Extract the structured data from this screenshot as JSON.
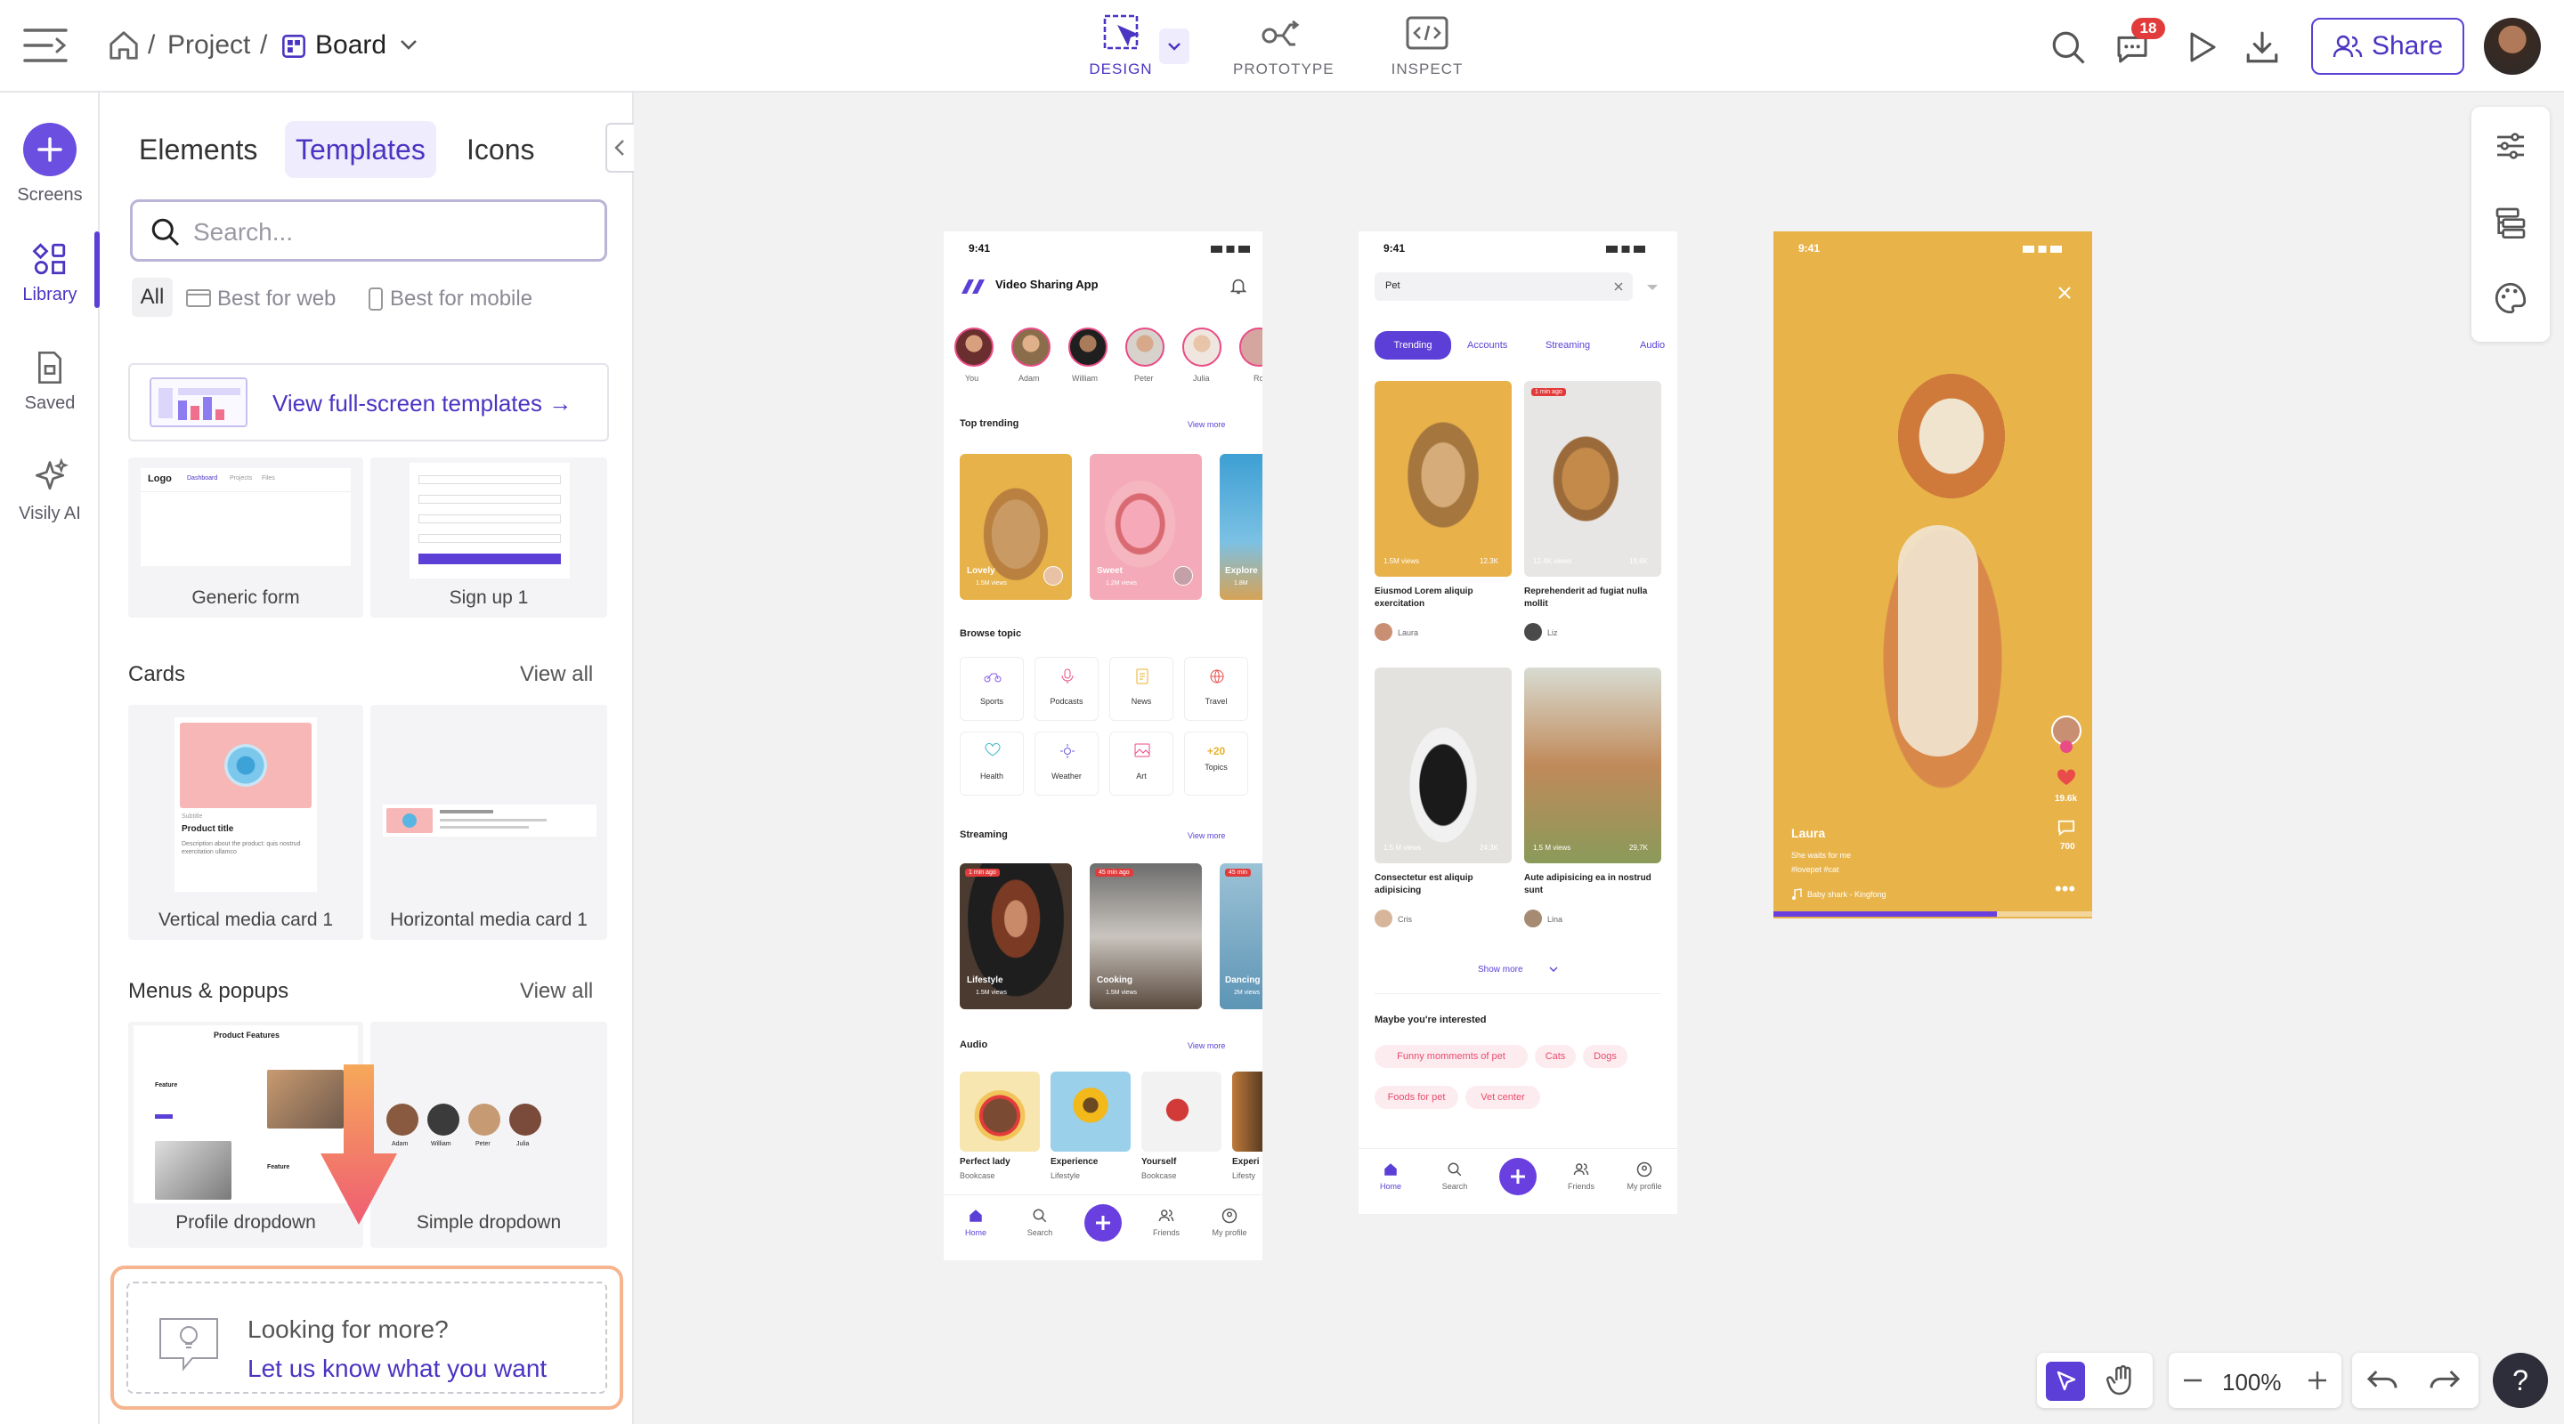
{
  "header": {
    "breadcrumb": {
      "project": "Project",
      "separator": "/",
      "board": "Board"
    },
    "modes": [
      {
        "label": "DESIGN"
      },
      {
        "label": "PROTOTYPE"
      },
      {
        "label": "INSPECT"
      }
    ],
    "notifications_count": "18",
    "share_label": "Share"
  },
  "leftnav": {
    "items": [
      {
        "label": "Screens"
      },
      {
        "label": "Library"
      },
      {
        "label": "Saved"
      },
      {
        "label": "Visily AI"
      }
    ]
  },
  "panel": {
    "tabs": [
      {
        "label": "Elements"
      },
      {
        "label": "Templates"
      },
      {
        "label": "Icons"
      }
    ],
    "active_tab": "Templates",
    "search_placeholder": "Search...",
    "filters": [
      {
        "label": "All"
      },
      {
        "label": "Best for web"
      },
      {
        "label": "Best for mobile"
      }
    ],
    "fullscreen_link": "View full-screen templates →",
    "top_templates": [
      {
        "label": "Generic form"
      },
      {
        "label": "Sign up 1"
      }
    ],
    "sections": [
      {
        "title": "Cards",
        "view_all": "View all",
        "items": [
          {
            "label": "Vertical media card 1"
          },
          {
            "label": "Horizontal media card 1"
          }
        ]
      },
      {
        "title": "Menus & popups",
        "view_all": "View all",
        "items": [
          {
            "label": "Profile dropdown"
          },
          {
            "label": "Simple dropdown"
          }
        ]
      }
    ],
    "feedback": {
      "line1": "Looking for more?",
      "line2": "Let us know what you want"
    },
    "preview_text": {
      "logo": "Logo",
      "dash": "Dashboard",
      "projects": "Projects",
      "files": "Files",
      "subtitle": "Subtitle",
      "product_title": "Product title",
      "desc": "Description about the product: quis nostrud exercitation ullamco",
      "product_features": "Product Features",
      "feature": "Feature",
      "people": [
        "Adam",
        "William",
        "Peter",
        "Julia"
      ]
    }
  },
  "screen1": {
    "time": "9:41",
    "app_title": "Video Sharing App",
    "stories": [
      {
        "name": "You"
      },
      {
        "name": "Adam"
      },
      {
        "name": "William"
      },
      {
        "name": "Peter"
      },
      {
        "name": "Julia"
      },
      {
        "name": "Ro"
      }
    ],
    "top_trending": "Top trending",
    "view_more": "View more",
    "trending_cards": [
      {
        "title": "Lovely",
        "views": "1.5M views"
      },
      {
        "title": "Sweet",
        "views": "1.2M views"
      },
      {
        "title": "Explore",
        "views": "1.8M"
      }
    ],
    "browse_topic": "Browse topic",
    "topics": [
      {
        "label": "Sports"
      },
      {
        "label": "Podcasts"
      },
      {
        "label": "News"
      },
      {
        "label": "Travel"
      },
      {
        "label": "Health"
      },
      {
        "label": "Weather"
      },
      {
        "label": "Art"
      },
      {
        "label": "Topics",
        "count": "+20"
      }
    ],
    "streaming": "Streaming",
    "stream_cards": [
      {
        "badge": "1 min ago",
        "title": "Lifestyle",
        "views": "1.5M views"
      },
      {
        "badge": "45 min ago",
        "title": "Cooking",
        "views": "1.5M views"
      },
      {
        "badge": "45 min",
        "title": "Dancing",
        "views": "2M views"
      }
    ],
    "audio": "Audio",
    "audio_items": [
      {
        "title": "Perfect lady",
        "sub": "Bookcase"
      },
      {
        "title": "Experience",
        "sub": "Lifestyle"
      },
      {
        "title": "Yourself",
        "sub": "Bookcase"
      },
      {
        "title": "Experi",
        "sub": "Lifesty"
      }
    ],
    "tabbar": [
      {
        "label": "Home"
      },
      {
        "label": "Search"
      },
      {
        "label": "Friends"
      },
      {
        "label": "My profile"
      }
    ]
  },
  "screen2": {
    "time": "9:41",
    "search_value": "Pet",
    "tabs": [
      {
        "label": "Trending"
      },
      {
        "label": "Accounts"
      },
      {
        "label": "Streaming"
      },
      {
        "label": "Audio"
      }
    ],
    "results": [
      {
        "views": "1.5M views",
        "likes": "12.3K",
        "title": "Eiusmod Lorem aliquip exercitation",
        "author": "Laura",
        "badge": ""
      },
      {
        "views": "12.4K views",
        "likes": "19,6K",
        "title": "Reprehenderit ad fugiat nulla mollit",
        "author": "Liz",
        "badge": "1 min ago"
      },
      {
        "views": "1.5 M views",
        "likes": "24.3K",
        "title": "Consectetur est aliquip adipisicing",
        "author": "Cris",
        "badge": ""
      },
      {
        "views": "1,5 M views",
        "likes": "29,7K",
        "title": "Aute adipisicing ea in nostrud sunt",
        "author": "Lina",
        "badge": ""
      }
    ],
    "show_more": "Show more",
    "interested_title": "Maybe you're interested",
    "interest_tags": [
      {
        "label": "Funny mommemts of pet"
      },
      {
        "label": "Cats"
      },
      {
        "label": "Dogs"
      },
      {
        "label": "Foods for pet"
      },
      {
        "label": "Vet center"
      }
    ],
    "tabbar": [
      {
        "label": "Home"
      },
      {
        "label": "Search"
      },
      {
        "label": "Friends"
      },
      {
        "label": "My profile"
      }
    ]
  },
  "screen3": {
    "time": "9:41",
    "author": "Laura",
    "caption": "She waits for me",
    "tags": "#lovepet  #cat",
    "song": "Baby shark - Kingfong",
    "likes": "19.6k",
    "comments": "700",
    "progress": 0.7
  },
  "zoom": {
    "level": "100%"
  },
  "colors": {
    "accent": "#5b3fd6",
    "accent_light": "#efecfd",
    "trending_yellow": "#e8b44a",
    "badge_red": "#e23b3b"
  }
}
